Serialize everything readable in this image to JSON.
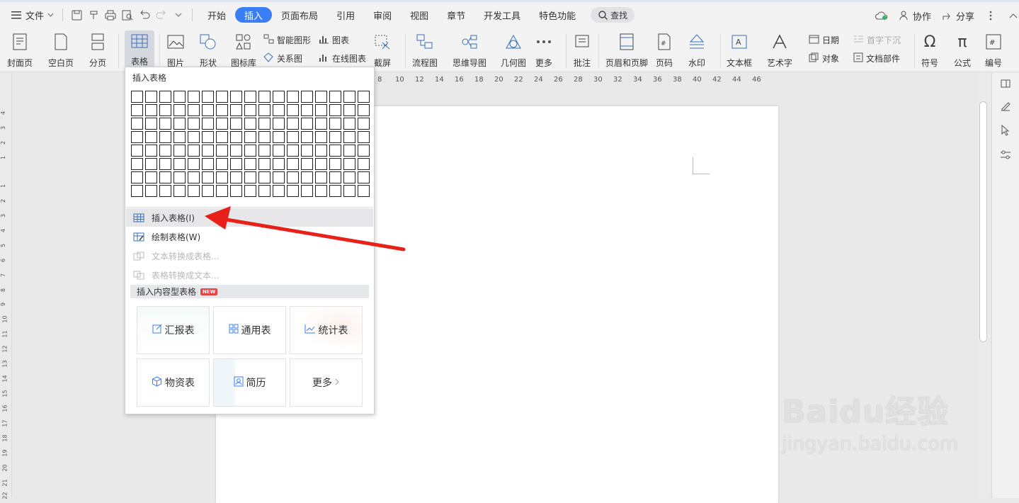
{
  "menubar": {
    "file_label": "文件",
    "tabs": [
      "开始",
      "插入",
      "页面布局",
      "引用",
      "审阅",
      "视图",
      "章节",
      "开发工具",
      "特色功能"
    ],
    "active_tab": "插入",
    "search_label": "查找",
    "collab_label": "协作",
    "share_label": "分享"
  },
  "ribbon": {
    "cover": "封面页",
    "blank": "空白页",
    "pagebreak": "分页",
    "table": "表格",
    "picture": "图片",
    "shape": "形状",
    "iconlib": "图标库",
    "smartart": "智能图形",
    "chart": "图表",
    "relation": "关系图",
    "onlinechart": "在线图表",
    "screenshot": "截屏",
    "flowchart": "流程图",
    "mindmap": "思维导图",
    "geometry": "几何图",
    "more": "更多",
    "comment": "批注",
    "headerfooter": "页眉和页脚",
    "pagenum": "页码",
    "watermark": "水印",
    "textbox": "文本框",
    "wordart": "艺术字",
    "date": "日期",
    "object": "对象",
    "dropcap": "首字下沉",
    "docpart": "文档部件",
    "symbol": "符号",
    "formula": "公式",
    "numbering": "编号"
  },
  "ruler": {
    "h_ticks": [
      "8",
      "10",
      "12",
      "14",
      "16",
      "18",
      "20",
      "22",
      "24",
      "26",
      "28",
      "30",
      "32",
      "34",
      "36",
      "38",
      "40",
      "42",
      "44",
      "46"
    ],
    "v_ticks": [
      "4",
      "3",
      "2",
      "1",
      "1",
      "2",
      "3",
      "4",
      "5",
      "6",
      "7",
      "8",
      "9",
      "10",
      "11",
      "12",
      "13",
      "14",
      "15",
      "16",
      "17",
      "18",
      "19",
      "20",
      "21",
      "22"
    ]
  },
  "dropdown": {
    "title": "插入表格",
    "items": {
      "insert_table": "插入表格(I)",
      "draw_table": "绘制表格(W)",
      "text_to_table": "文本转换成表格...",
      "table_to_text": "表格转换成文本..."
    },
    "section_title": "插入内容型表格",
    "new_badge": "NEW",
    "templates": {
      "report": "汇报表",
      "general": "通用表",
      "stats": "统计表",
      "material": "物资表",
      "resume": "简历",
      "more": "更多"
    },
    "colors": {
      "arrow": "#e8201a",
      "accent": "#3a7ef5",
      "new_badge": "#e64545"
    }
  },
  "watermark": {
    "logo": "Baidu经验",
    "url": "jingyan.baidu.com"
  }
}
